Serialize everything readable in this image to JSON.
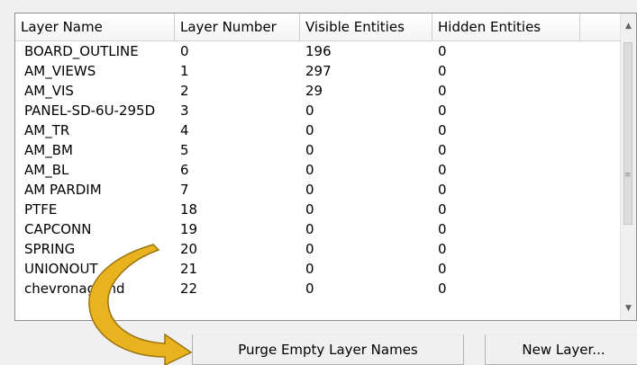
{
  "layers_table": {
    "columns": [
      "Layer Name",
      "Layer Number",
      "Visible Entities",
      "Hidden Entities"
    ],
    "rows": [
      [
        "BOARD_OUTLINE",
        "0",
        "196",
        "0"
      ],
      [
        "AM_VIEWS",
        "1",
        "297",
        "0"
      ],
      [
        "AM_VIS",
        "2",
        "29",
        "0"
      ],
      [
        "PANEL-SD-6U-295D",
        "3",
        "0",
        "0"
      ],
      [
        "AM_TR",
        "4",
        "0",
        "0"
      ],
      [
        "AM_BM",
        "5",
        "0",
        "0"
      ],
      [
        "AM_BL",
        "6",
        "0",
        "0"
      ],
      [
        "AM PARDIM",
        "7",
        "0",
        "0"
      ],
      [
        "PTFE",
        "18",
        "0",
        "0"
      ],
      [
        "CAPCONN",
        "19",
        "0",
        "0"
      ],
      [
        "SPRING",
        "20",
        "0",
        "0"
      ],
      [
        "UNIONOUT",
        "21",
        "0",
        "0"
      ],
      [
        "chevronagland",
        "22",
        "0",
        "0"
      ]
    ]
  },
  "buttons": {
    "purge_label": "Purge Empty Layer Names",
    "new_layer_label": "New Layer..."
  },
  "scrollbar": {
    "up_glyph": "▲",
    "down_glyph": "▼",
    "grip_glyph": "≡"
  },
  "colors": {
    "annotation_arrow": "#e8b31f",
    "annotation_arrow_outline": "#9a7410"
  }
}
